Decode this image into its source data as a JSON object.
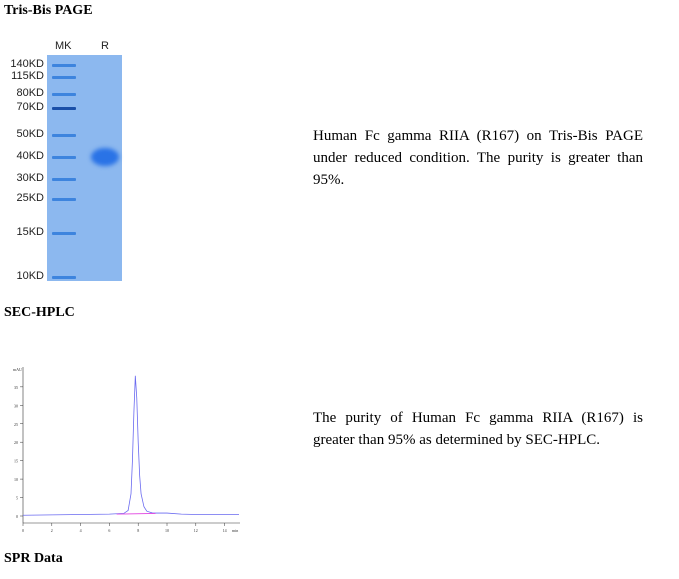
{
  "sections": {
    "page": "Tris-Bis PAGE",
    "sec": "SEC-HPLC",
    "spr": "SPR Data"
  },
  "gel": {
    "lanes": [
      "MK",
      "R"
    ],
    "markers": [
      "140KD",
      "115KD",
      "80KD",
      "70KD",
      "50KD",
      "40KD",
      "30KD",
      "25KD",
      "15KD",
      "10KD"
    ]
  },
  "descriptions": {
    "page": "Human Fc gamma RIIA (R167) on Tris-Bis PAGE under reduced condition. The purity is greater than 95%.",
    "sec": "The purity of Human Fc gamma RIIA (R167) is greater than 95% as determined by SEC-HPLC."
  },
  "chart_data": {
    "type": "line",
    "ylabel": "mAU",
    "xlabel": "min",
    "xlim": [
      0,
      15
    ],
    "ylim": [
      -1,
      40
    ],
    "xticks": [
      "0",
      "2",
      "4",
      "6",
      "8",
      "10",
      "12",
      "14"
    ],
    "yticks": [
      "0",
      "5",
      "10",
      "15",
      "20",
      "25",
      "30",
      "35"
    ],
    "series": [
      {
        "color": "#6a6af0",
        "x": [
          0,
          2,
          4,
          6,
          7,
          7.3,
          7.5,
          7.6,
          7.7,
          7.8,
          7.9,
          8.0,
          8.1,
          8.2,
          8.4,
          8.6,
          9,
          10,
          11,
          12,
          14,
          15
        ],
        "y": [
          0.2,
          0.3,
          0.4,
          0.5,
          0.7,
          1.5,
          6,
          15,
          28,
          38,
          32,
          20,
          11,
          6,
          2.5,
          1.3,
          0.8,
          0.8,
          0.5,
          0.4,
          0.4,
          0.4
        ]
      },
      {
        "color": "#e040e0",
        "x": [
          6.5,
          9.2
        ],
        "y": [
          0.5,
          0.7
        ]
      }
    ]
  }
}
